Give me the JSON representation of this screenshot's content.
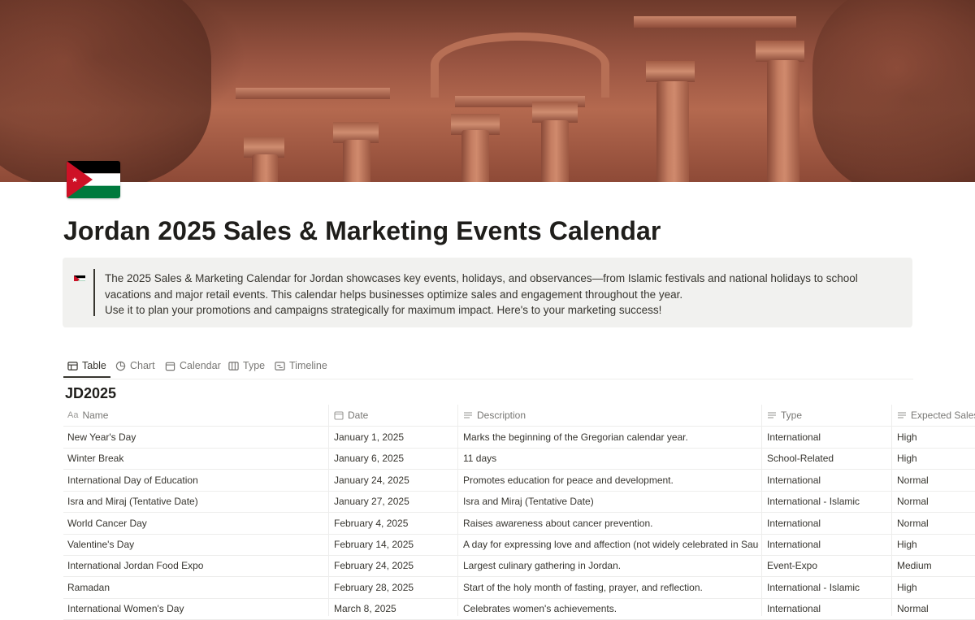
{
  "page": {
    "title": "Jordan 2025 Sales & Marketing Events Calendar",
    "icon": "jordan-flag-icon"
  },
  "callout": {
    "icon": "jordan-flag-icon",
    "line1": "The 2025 Sales & Marketing Calendar for Jordan showcases key events, holidays, and observances—from Islamic festivals and national holidays to school",
    "line2": "vacations and major retail events. This calendar helps businesses optimize sales and engagement throughout the year.",
    "line3": "Use it to plan your promotions and campaigns strategically for maximum impact. Here's to your marketing success!"
  },
  "views": [
    {
      "label": "Table",
      "icon": "table-icon",
      "active": true
    },
    {
      "label": "Chart",
      "icon": "chart-icon"
    },
    {
      "label": "Calendar",
      "icon": "calendar-icon"
    },
    {
      "label": "Type",
      "icon": "board-icon"
    },
    {
      "label": "Timeline",
      "icon": "timeline-icon"
    }
  ],
  "database": {
    "title": "JD2025",
    "columns": [
      {
        "label": "Name",
        "icon": "title-property-icon"
      },
      {
        "label": "Date",
        "icon": "date-property-icon"
      },
      {
        "label": "Description",
        "icon": "text-property-icon"
      },
      {
        "label": "Type",
        "icon": "text-property-icon"
      },
      {
        "label": "Expected Sales",
        "icon": "text-property-icon"
      }
    ],
    "rows": [
      {
        "name": "New Year's Day",
        "date": "January 1, 2025",
        "description": "Marks the beginning of the Gregorian calendar year.",
        "type": "International",
        "sales": "High"
      },
      {
        "name": "Winter Break",
        "date": "January 6, 2025",
        "description": "11 days",
        "type": "School-Related",
        "sales": "High"
      },
      {
        "name": "International Day of Education",
        "date": "January 24, 2025",
        "description": "Promotes education for peace and development.",
        "type": "International",
        "sales": "Normal"
      },
      {
        "name": "Isra and Miraj (Tentative Date)",
        "date": "January 27, 2025",
        "description": "Isra and Miraj (Tentative Date)",
        "type": "International - Islamic",
        "sales": "Normal"
      },
      {
        "name": "World Cancer Day",
        "date": "February 4, 2025",
        "description": "Raises awareness about cancer prevention.",
        "type": "International",
        "sales": "Normal"
      },
      {
        "name": "Valentine's Day",
        "date": "February 14, 2025",
        "description": "A day for expressing love and affection (not widely celebrated in Saudi Arabia).",
        "type": "International",
        "sales": "High"
      },
      {
        "name": "International Jordan Food Expo",
        "date": "February 24, 2025",
        "description": "Largest culinary gathering in Jordan.",
        "type": "Event-Expo",
        "sales": "Medium"
      },
      {
        "name": "Ramadan",
        "date": "February 28, 2025",
        "description": "Start of the holy month of fasting, prayer, and reflection.",
        "type": "International - Islamic",
        "sales": "High"
      },
      {
        "name": "International Women's Day",
        "date": "March 8, 2025",
        "description": "Celebrates women's achievements.",
        "type": "International",
        "sales": "Normal"
      }
    ]
  },
  "colors": {
    "text": "#37352f",
    "muted": "#787774",
    "callout_bg": "#f1f1ef",
    "border": "#ededec",
    "flag_black": "#000000",
    "flag_green": "#007a3d",
    "flag_red": "#ce1126"
  }
}
